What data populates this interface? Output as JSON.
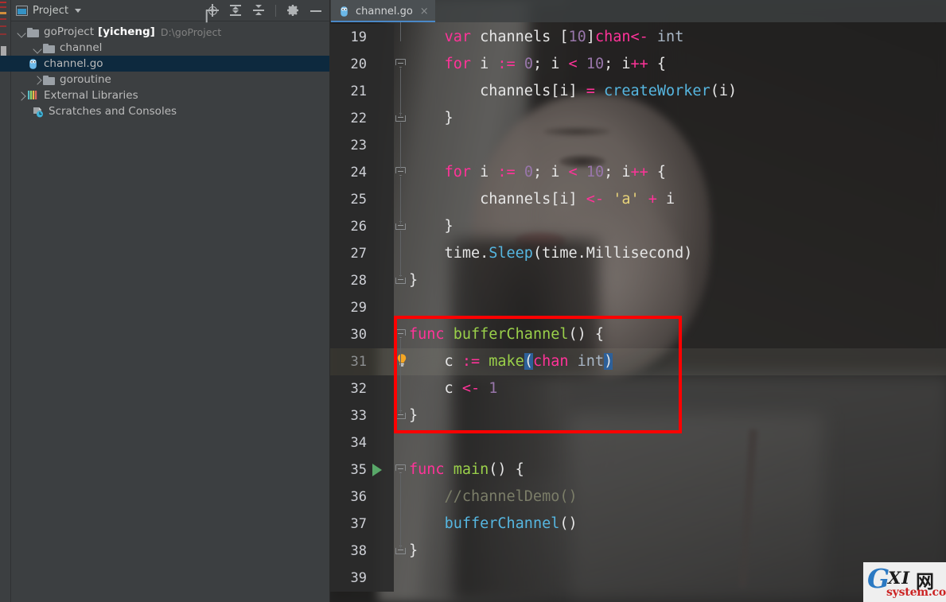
{
  "window": {
    "left_strip_name": "tool-window-strip"
  },
  "project_panel": {
    "title": "Project",
    "title_icon": "project-window-icon",
    "dropdown_icon": "chevron-down-icon",
    "actions": [
      {
        "name": "locate-in-tree-icon",
        "label": "Select Opened File"
      },
      {
        "name": "expand-all-icon",
        "label": "Expand All"
      },
      {
        "name": "collapse-all-icon",
        "label": "Collapse All"
      },
      {
        "name": "gear-icon",
        "label": "Settings"
      },
      {
        "name": "minimize-icon",
        "label": "Hide"
      }
    ],
    "tree": [
      {
        "label": "goProject",
        "bracket": "[yicheng]",
        "path": "D:\\goProject",
        "icon": "folder-icon",
        "state": "expanded",
        "depth": 0,
        "selected": false
      },
      {
        "label": "channel",
        "icon": "folder-icon",
        "state": "expanded",
        "depth": 1,
        "selected": false
      },
      {
        "label": "channel.go",
        "icon": "go-file-icon",
        "state": "leaf",
        "depth": 2,
        "selected": true
      },
      {
        "label": "goroutine",
        "icon": "folder-icon",
        "state": "collapsed",
        "depth": 1,
        "selected": false
      },
      {
        "label": "External Libraries",
        "icon": "library-icon",
        "state": "collapsed",
        "depth": 0,
        "selected": false
      },
      {
        "label": "Scratches and Consoles",
        "icon": "scratches-icon",
        "state": "leaf",
        "depth": 0,
        "selected": false
      }
    ]
  },
  "editor": {
    "tab": {
      "label": "channel.go",
      "icon": "go-file-icon",
      "close_label": "×",
      "active": true
    },
    "current_line": 31,
    "first_line": 19,
    "lines": [
      {
        "no": "19",
        "fold": "",
        "tokens": [
          {
            "t": "    ",
            "c": "plain"
          },
          {
            "t": "var",
            "c": "gokw"
          },
          {
            "t": " channels ",
            "c": "plain"
          },
          {
            "t": "[",
            "c": "plain"
          },
          {
            "t": "10",
            "c": "num"
          },
          {
            "t": "]",
            "c": "plain"
          },
          {
            "t": "chan",
            "c": "gokw"
          },
          {
            "t": "<-",
            "c": "op"
          },
          {
            "t": " ",
            "c": "plain"
          },
          {
            "t": "int",
            "c": "type"
          }
        ]
      },
      {
        "no": "20",
        "fold": "open",
        "tokens": [
          {
            "t": "    ",
            "c": "plain"
          },
          {
            "t": "for",
            "c": "gokw"
          },
          {
            "t": " i ",
            "c": "plain"
          },
          {
            "t": ":=",
            "c": "op"
          },
          {
            "t": " ",
            "c": "plain"
          },
          {
            "t": "0",
            "c": "num"
          },
          {
            "t": "; i ",
            "c": "plain"
          },
          {
            "t": "<",
            "c": "op"
          },
          {
            "t": " ",
            "c": "plain"
          },
          {
            "t": "10",
            "c": "num"
          },
          {
            "t": "; i",
            "c": "plain"
          },
          {
            "t": "++",
            "c": "op"
          },
          {
            "t": " {",
            "c": "plain"
          }
        ]
      },
      {
        "no": "21",
        "fold": "",
        "tokens": [
          {
            "t": "        channels[i] ",
            "c": "plain"
          },
          {
            "t": "=",
            "c": "op"
          },
          {
            "t": " ",
            "c": "plain"
          },
          {
            "t": "createWorker",
            "c": "fn"
          },
          {
            "t": "(i)",
            "c": "plain"
          }
        ]
      },
      {
        "no": "22",
        "fold": "close",
        "tokens": [
          {
            "t": "    }",
            "c": "plain"
          }
        ]
      },
      {
        "no": "23",
        "fold": "",
        "tokens": []
      },
      {
        "no": "24",
        "fold": "open",
        "tokens": [
          {
            "t": "    ",
            "c": "plain"
          },
          {
            "t": "for",
            "c": "gokw"
          },
          {
            "t": " i ",
            "c": "plain"
          },
          {
            "t": ":=",
            "c": "op"
          },
          {
            "t": " ",
            "c": "plain"
          },
          {
            "t": "0",
            "c": "num"
          },
          {
            "t": "; i ",
            "c": "plain"
          },
          {
            "t": "<",
            "c": "op"
          },
          {
            "t": " ",
            "c": "plain"
          },
          {
            "t": "10",
            "c": "num"
          },
          {
            "t": "; i",
            "c": "plain"
          },
          {
            "t": "++",
            "c": "op"
          },
          {
            "t": " {",
            "c": "plain"
          }
        ]
      },
      {
        "no": "25",
        "fold": "",
        "tokens": [
          {
            "t": "        channels[i] ",
            "c": "plain"
          },
          {
            "t": "<-",
            "c": "op"
          },
          {
            "t": " ",
            "c": "plain"
          },
          {
            "t": "'a'",
            "c": "str"
          },
          {
            "t": " ",
            "c": "plain"
          },
          {
            "t": "+",
            "c": "op"
          },
          {
            "t": " i",
            "c": "plain"
          }
        ]
      },
      {
        "no": "26",
        "fold": "close",
        "tokens": [
          {
            "t": "    }",
            "c": "plain"
          }
        ]
      },
      {
        "no": "27",
        "fold": "",
        "tokens": [
          {
            "t": "    time.",
            "c": "plain"
          },
          {
            "t": "Sleep",
            "c": "fn"
          },
          {
            "t": "(time.Millisecond)",
            "c": "plain"
          }
        ]
      },
      {
        "no": "28",
        "fold": "close",
        "tokens": [
          {
            "t": "}",
            "c": "plain"
          }
        ]
      },
      {
        "no": "29",
        "fold": "",
        "tokens": []
      },
      {
        "no": "30",
        "fold": "open",
        "tokens": [
          {
            "t": "func",
            "c": "gokw"
          },
          {
            "t": " ",
            "c": "plain"
          },
          {
            "t": "bufferChannel",
            "c": "fndef"
          },
          {
            "t": "() {",
            "c": "plain"
          }
        ]
      },
      {
        "no": "31",
        "fold": "bulb",
        "tokens": [
          {
            "t": "    c ",
            "c": "plain"
          },
          {
            "t": ":=",
            "c": "op"
          },
          {
            "t": " ",
            "c": "plain"
          },
          {
            "t": "make",
            "c": "fndef"
          },
          {
            "t": "(",
            "c": "sel-brkt"
          },
          {
            "t": "chan",
            "c": "gokw"
          },
          {
            "t": " ",
            "c": "plain"
          },
          {
            "t": "int",
            "c": "type"
          },
          {
            "t": ")",
            "c": "sel-brkt"
          }
        ]
      },
      {
        "no": "32",
        "fold": "",
        "tokens": [
          {
            "t": "    c ",
            "c": "plain"
          },
          {
            "t": "<-",
            "c": "op"
          },
          {
            "t": " ",
            "c": "plain"
          },
          {
            "t": "1",
            "c": "num"
          }
        ]
      },
      {
        "no": "33",
        "fold": "close",
        "tokens": [
          {
            "t": "}",
            "c": "plain"
          }
        ]
      },
      {
        "no": "34",
        "fold": "",
        "tokens": []
      },
      {
        "no": "35",
        "fold": "open",
        "run": true,
        "tokens": [
          {
            "t": "func",
            "c": "gokw"
          },
          {
            "t": " ",
            "c": "plain"
          },
          {
            "t": "main",
            "c": "fndef"
          },
          {
            "t": "() {",
            "c": "plain"
          }
        ]
      },
      {
        "no": "36",
        "fold": "",
        "tokens": [
          {
            "t": "    //channelDemo()",
            "c": "cmt"
          }
        ]
      },
      {
        "no": "37",
        "fold": "",
        "tokens": [
          {
            "t": "    ",
            "c": "plain"
          },
          {
            "t": "bufferChannel",
            "c": "fn"
          },
          {
            "t": "()",
            "c": "plain"
          }
        ]
      },
      {
        "no": "38",
        "fold": "close",
        "tokens": [
          {
            "t": "}",
            "c": "plain"
          }
        ]
      },
      {
        "no": "39",
        "fold": "",
        "tokens": []
      }
    ],
    "annotation": {
      "name": "red-highlight-box",
      "color": "#ff0000",
      "covers_lines": "30-33"
    },
    "gutter_icons": {
      "intention_bulb": "lightbulb-icon",
      "run_marker": "run-gutter-icon",
      "fold_open": "fold-open-icon",
      "fold_close": "fold-close-icon"
    }
  },
  "watermark": {
    "g": "G",
    "xi": "XI",
    "wang": "网",
    "domain": "system.com"
  },
  "colors": {
    "accent": "#4a88c7",
    "selection": "#0d293e",
    "annotation": "#ff0000",
    "keyword": "#ff3399",
    "function": "#56b6e0",
    "function_def": "#9ad04a",
    "number": "#9876aa",
    "string": "#e8d37a",
    "comment": "#7b7d68",
    "bracket_match": "#2d6099"
  }
}
